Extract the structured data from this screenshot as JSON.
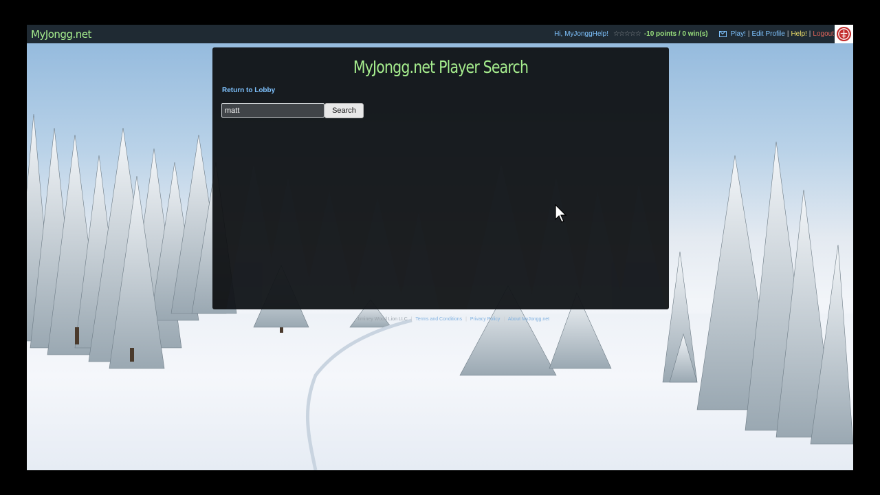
{
  "topbar": {
    "brand": "MyJongg.net",
    "greeting": "Hi, MyJonggHelp!",
    "stars": "☆☆☆☆☆",
    "points": "-10 points / 0 win(s)",
    "play": "Play!",
    "edit_profile": "Edit Profile",
    "help": "Help!",
    "logout": "Logout",
    "separator": "|"
  },
  "panel": {
    "title": "MyJongg.net Player Search",
    "return_link": "Return to Lobby",
    "search_value": "matt",
    "search_button": "Search"
  },
  "footer": {
    "copyright": "Jiminey Wood Lion LLC",
    "terms": "Terms and Conditions",
    "privacy": "Privacy Policy",
    "about": "About MyJongg.net",
    "separator": "|"
  },
  "colors": {
    "accent_green": "#a6ee8e",
    "link_blue": "#7fc3ff",
    "help_yellow": "#f1e26b",
    "logout_red": "#e0645a",
    "topbar_bg": "#1f2a33"
  },
  "icons": [
    "envelope-icon",
    "logo-icon",
    "mouse-cursor-icon"
  ]
}
